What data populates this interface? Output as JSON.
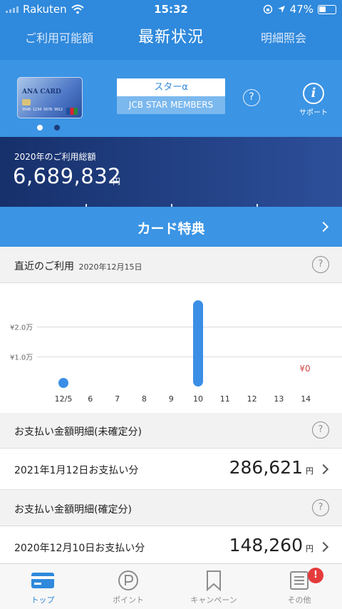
{
  "status": {
    "carrier": "Rakuten",
    "time": "15:32",
    "battery": "47%"
  },
  "nav": {
    "left": "ご利用可能額",
    "title": "最新状況",
    "right": "明細照会"
  },
  "card": {
    "brand": "ANA CARD",
    "number_text": "3540 1234 5678 9012",
    "plan_name": "スターα",
    "plan_program": "JCB STAR MEMBERS",
    "support_label": "サポート"
  },
  "total": {
    "caption": "2020年のご利用総額",
    "amount": "6,689,832",
    "unit": "円"
  },
  "benefit": {
    "label": "カード特典"
  },
  "recent": {
    "title": "直近のご利用",
    "date": "2020年12月15日"
  },
  "chart_data": {
    "type": "bar",
    "categories": [
      "12/5",
      "6",
      "7",
      "8",
      "9",
      "10",
      "11",
      "12",
      "13",
      "14"
    ],
    "values": [
      2000,
      0,
      0,
      0,
      0,
      29000,
      0,
      0,
      0,
      0
    ],
    "ytick_labels": [
      "¥2.0万",
      "¥1.0万"
    ],
    "yticks": [
      20000,
      10000
    ],
    "ylim": [
      0,
      30000
    ],
    "annotation": "¥0",
    "color": "#3b8ee6"
  },
  "unconfirmed": {
    "title": "お支払い金額明細(未確定分)",
    "date": "2021年1月12日お支払い分",
    "amount": "286,621",
    "unit": "円"
  },
  "confirmed": {
    "title": "お支払い金額明細(確定分)",
    "date": "2020年12月10日お支払い分",
    "amount": "148,260",
    "unit": "円"
  },
  "tabs": [
    {
      "label": "トップ",
      "icon": "card-icon"
    },
    {
      "label": "ポイント",
      "icon": "points-icon"
    },
    {
      "label": "キャンペーン",
      "icon": "bookmark-icon"
    },
    {
      "label": "その他",
      "icon": "list-icon"
    }
  ],
  "notification_badge": "!"
}
